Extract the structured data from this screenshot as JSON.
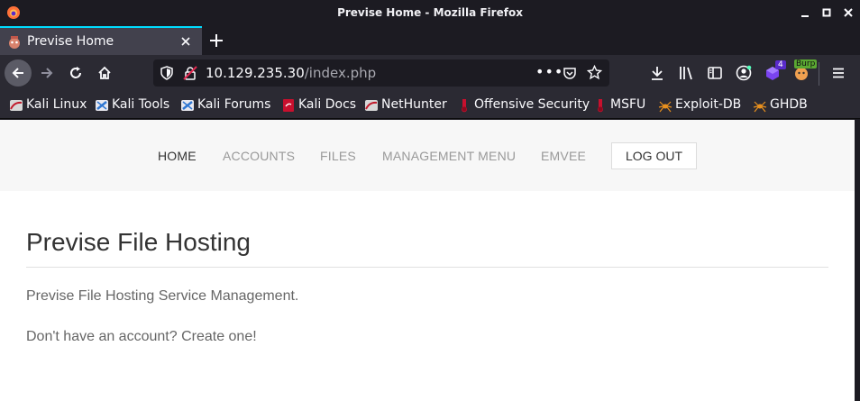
{
  "window": {
    "title": "Previse Home - Mozilla Firefox"
  },
  "tabs": [
    {
      "label": "Previse Home",
      "active": true
    }
  ],
  "urlbar": {
    "host": "10.129.235.30",
    "path": "/index.php"
  },
  "toolbar_badges": {
    "extension_count": "4",
    "burp_label": "Burp"
  },
  "bookmarks": [
    {
      "label": "Kali Linux",
      "icon": "kali-dragon-icon"
    },
    {
      "label": "Kali Tools",
      "icon": "kali-tools-icon"
    },
    {
      "label": "Kali Forums",
      "icon": "kali-forums-icon"
    },
    {
      "label": "Kali Docs",
      "icon": "kali-docs-icon"
    },
    {
      "label": "NetHunter",
      "icon": "kali-dragon-icon"
    },
    {
      "label": "Offensive Security",
      "icon": "offsec-icon"
    },
    {
      "label": "MSFU",
      "icon": "offsec-icon"
    },
    {
      "label": "Exploit-DB",
      "icon": "exploitdb-spider-icon"
    },
    {
      "label": "GHDB",
      "icon": "exploitdb-spider-icon"
    }
  ],
  "site_nav": {
    "items": [
      "HOME",
      "ACCOUNTS",
      "FILES",
      "MANAGEMENT MENU",
      "EMVEE"
    ],
    "active_index": 0,
    "logout_label": "LOG OUT"
  },
  "content": {
    "heading": "Previse File Hosting",
    "paragraph1": "Previse File Hosting Service Management.",
    "paragraph2": "Don't have an account? Create one!"
  },
  "colors": {
    "accent": "#00ddff",
    "chrome_dark": "#1c1b22",
    "toolbar": "#2b2a33",
    "nav_bg": "#f7f7f7"
  }
}
